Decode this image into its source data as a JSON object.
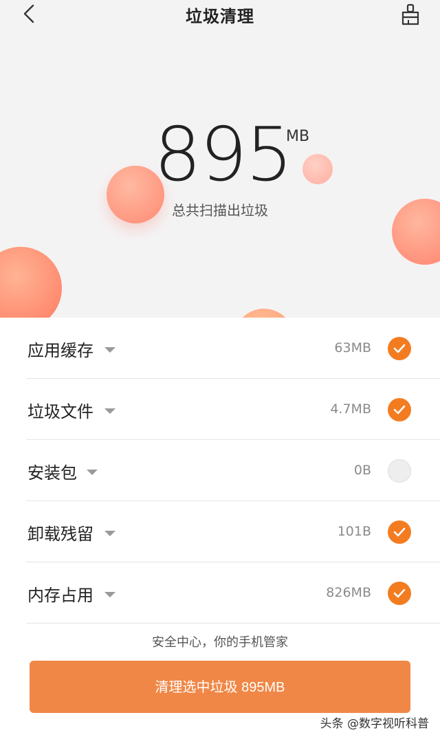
{
  "header": {
    "title": "垃圾清理"
  },
  "scan": {
    "size_value": "895",
    "size_unit": "MB",
    "caption": "总共扫描出垃圾"
  },
  "items": [
    {
      "label": "应用缓存",
      "size": "63MB",
      "checked": true
    },
    {
      "label": "垃圾文件",
      "size": "4.7MB",
      "checked": true
    },
    {
      "label": "安装包",
      "size": "0B",
      "checked": false
    },
    {
      "label": "卸载残留",
      "size": "101B",
      "checked": true
    },
    {
      "label": "内存占用",
      "size": "826MB",
      "checked": true
    }
  ],
  "footer": {
    "note": "安全中心，你的手机管家",
    "clean_button": "清理选中垃圾 895MB"
  },
  "watermark": "头条 @数字视听科普",
  "colors": {
    "accent": "#f37c21",
    "button": "#f08746",
    "bubble": "#ff8a72"
  }
}
